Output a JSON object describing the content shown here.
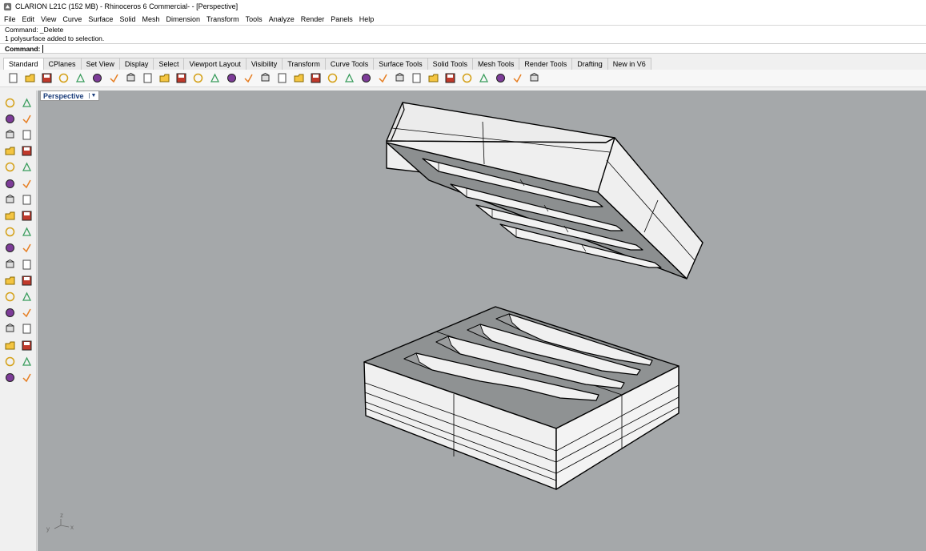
{
  "window": {
    "title": "CLARION  L21C (152 MB) - Rhinoceros 6 Commercial- - [Perspective]"
  },
  "menu": [
    "File",
    "Edit",
    "View",
    "Curve",
    "Surface",
    "Solid",
    "Mesh",
    "Dimension",
    "Transform",
    "Tools",
    "Analyze",
    "Render",
    "Panels",
    "Help"
  ],
  "command_history": [
    "Command: _Delete",
    "1 polysurface added to selection."
  ],
  "command_prompt": "Command:",
  "toolbar_tabs": [
    "Standard",
    "CPlanes",
    "Set View",
    "Display",
    "Select",
    "Viewport Layout",
    "Visibility",
    "Transform",
    "Curve Tools",
    "Surface Tools",
    "Solid Tools",
    "Mesh Tools",
    "Render Tools",
    "Drafting",
    "New in V6"
  ],
  "toolbar_icons": [
    "new-file-icon",
    "open-file-icon",
    "save-icon",
    "print-icon",
    "import-icon",
    "cut-icon",
    "copy-icon",
    "paste-icon",
    "undo-icon",
    "pan-hand-icon",
    "move-view-icon",
    "zoom-icon",
    "zoom-window-icon",
    "zoom-extents-icon",
    "zoom-selected-icon",
    "rotate-view-icon",
    "four-viewports-icon",
    "car-icon",
    "hide-icon",
    "lock-icon",
    "lightbulb-icon",
    "lock-object-icon",
    "layer-icon",
    "color-wheel-icon",
    "render-sphere-icon",
    "shaded-sphere-icon",
    "blue-sphere-icon",
    "brush-icon",
    "gear-icon",
    "options-icon",
    "globe-icon",
    "help-icon"
  ],
  "left_tools": [
    [
      "select-arrow-icon",
      "point-icon"
    ],
    [
      "polyline-icon",
      "curve-icon"
    ],
    [
      "circle-icon",
      "ellipse-icon"
    ],
    [
      "arc-icon",
      "rectangle-icon"
    ],
    [
      "polygon-icon",
      "fillet-curve-icon"
    ],
    [
      "surface-icon",
      "sweep-icon"
    ],
    [
      "box-solid-icon",
      "sphere-solid-icon"
    ],
    [
      "cylinder-solid-icon",
      "mesh-icon"
    ],
    [
      "light-icon",
      "explode-icon"
    ],
    [
      "extend-icon",
      "trim-icon"
    ],
    [
      "boolean-icon",
      "join-icon"
    ],
    [
      "offset-icon",
      "rebuild-icon"
    ],
    [
      "text-icon",
      "dimension-icon"
    ],
    [
      "group-icon",
      "block-icon"
    ],
    [
      "cage-edit-icon",
      "gumball-icon"
    ],
    [
      "array-icon",
      "align-icon"
    ],
    [
      "analyze-icon",
      "check-icon"
    ],
    [
      "render-icon",
      "paint-icon"
    ]
  ],
  "viewport": {
    "label": "Perspective",
    "axes": {
      "x": "x",
      "y": "y",
      "z": "z"
    }
  },
  "colors": {
    "viewport_bg": "#a5a8aa",
    "face_light": "#eeeeee",
    "face_dark": "#8f9192",
    "edge": "#000000",
    "tab_text": "#1a3c7a"
  }
}
